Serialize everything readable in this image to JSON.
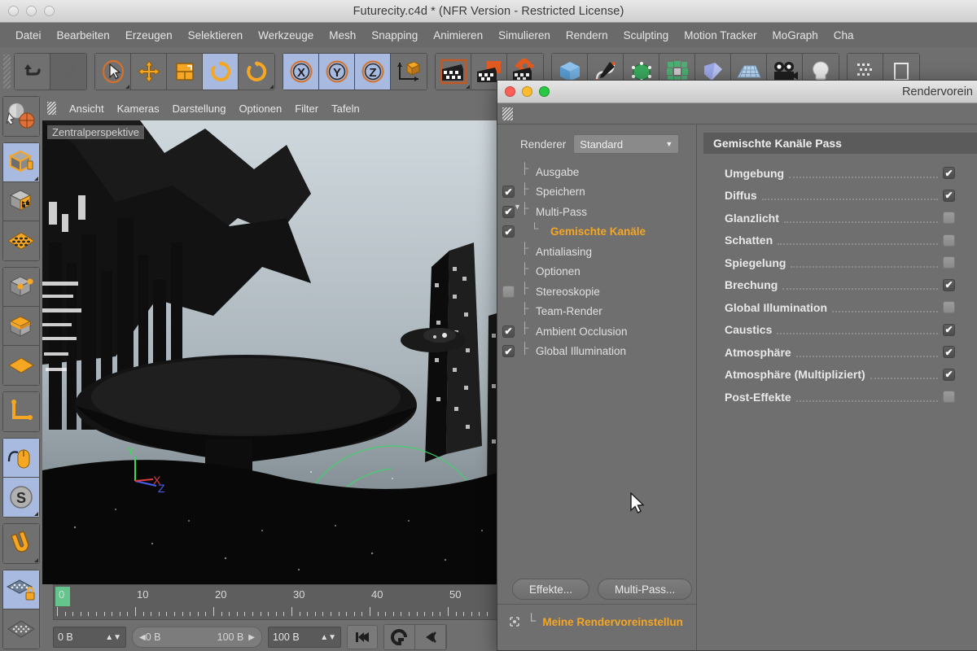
{
  "window": {
    "title": "Futurecity.c4d * (NFR Version - Restricted License)",
    "traffic_lights": [
      "close",
      "minimize",
      "zoom"
    ]
  },
  "menubar": {
    "items": [
      {
        "label": "Datei"
      },
      {
        "label": "Bearbeiten"
      },
      {
        "label": "Erzeugen"
      },
      {
        "label": "Selektieren"
      },
      {
        "label": "Werkzeuge"
      },
      {
        "label": "Mesh"
      },
      {
        "label": "Snapping"
      },
      {
        "label": "Animieren"
      },
      {
        "label": "Simulieren"
      },
      {
        "label": "Rendern"
      },
      {
        "label": "Sculpting"
      },
      {
        "label": "Motion Tracker"
      },
      {
        "label": "MoGraph"
      },
      {
        "label": "Cha"
      }
    ]
  },
  "toolbar": {
    "groups": [
      {
        "name": "history",
        "buttons": [
          {
            "icon": "undo-icon",
            "active": false,
            "dim": false
          },
          {
            "icon": "redo-icon",
            "active": false,
            "dim": true
          }
        ]
      },
      {
        "name": "transform",
        "buttons": [
          {
            "icon": "select-arrow-icon",
            "active": false,
            "dim": false,
            "corner": true
          },
          {
            "icon": "move-icon",
            "active": false,
            "dim": false
          },
          {
            "icon": "scale-icon",
            "active": false,
            "dim": false
          },
          {
            "icon": "rotate-icon",
            "active": true,
            "dim": false
          },
          {
            "icon": "rotate-alt-icon",
            "active": false,
            "dim": false,
            "corner": true
          }
        ]
      },
      {
        "name": "axis-locks",
        "buttons": [
          {
            "icon": "axis-x-icon",
            "active": true,
            "dim": false
          },
          {
            "icon": "axis-y-icon",
            "active": true,
            "dim": false
          },
          {
            "icon": "axis-z-icon",
            "active": true,
            "dim": false
          },
          {
            "icon": "world-coord-icon",
            "active": false,
            "dim": false
          }
        ]
      },
      {
        "name": "render",
        "buttons": [
          {
            "icon": "render-view-icon",
            "active": false,
            "dim": false,
            "corner": true
          },
          {
            "icon": "render-picture-viewer-icon",
            "active": false,
            "dim": false
          },
          {
            "icon": "render-settings-icon",
            "active": false,
            "dim": false
          }
        ]
      },
      {
        "name": "objects",
        "buttons": [
          {
            "icon": "cube-primitive-icon",
            "active": false,
            "dim": false
          },
          {
            "icon": "spline-pen-icon",
            "active": false,
            "dim": false
          },
          {
            "icon": "generator-icon",
            "active": false,
            "dim": false
          },
          {
            "icon": "deformer-icon",
            "active": false,
            "dim": false
          },
          {
            "icon": "environment-icon",
            "active": false,
            "dim": false
          },
          {
            "icon": "floor-icon",
            "active": false,
            "dim": false
          },
          {
            "icon": "camera-icon",
            "active": false,
            "dim": false
          },
          {
            "icon": "light-icon",
            "active": false,
            "dim": false
          }
        ]
      },
      {
        "name": "extras",
        "buttons": [
          {
            "icon": "grid-icon",
            "active": false,
            "dim": false
          },
          {
            "icon": "panel-icon",
            "active": false,
            "dim": false
          }
        ]
      }
    ]
  },
  "left_rail": {
    "groups": [
      {
        "buttons": [
          {
            "icon": "world-axis-icon",
            "active": false
          }
        ]
      },
      {
        "buttons": [
          {
            "icon": "object-mode-icon",
            "active": true,
            "corner": true
          },
          {
            "icon": "points-mode-icon",
            "active": false
          },
          {
            "icon": "polygon-mode-icon",
            "active": false
          }
        ]
      },
      {
        "buttons": [
          {
            "icon": "model-mode-icon",
            "active": false
          },
          {
            "icon": "texture-mode-icon",
            "active": false
          },
          {
            "icon": "workplane-mode-icon",
            "active": false
          }
        ]
      },
      {
        "buttons": [
          {
            "icon": "object-axis-icon",
            "active": false
          }
        ]
      },
      {
        "buttons": [
          {
            "icon": "viewport-lock-icon",
            "active": true
          },
          {
            "icon": "soft-selection-icon",
            "active": true,
            "corner": true
          }
        ]
      },
      {
        "buttons": [
          {
            "icon": "magnet-icon",
            "active": false,
            "corner": true
          }
        ]
      },
      {
        "buttons": [
          {
            "icon": "workplane-lock-icon",
            "active": true
          },
          {
            "icon": "grid-plane-icon",
            "active": false
          }
        ]
      }
    ]
  },
  "viewport": {
    "menu": [
      {
        "label": "Ansicht"
      },
      {
        "label": "Kameras"
      },
      {
        "label": "Darstellung"
      },
      {
        "label": "Optionen"
      },
      {
        "label": "Filter"
      },
      {
        "label": "Tafeln"
      }
    ],
    "label": "Zentralperspektive",
    "axis": {
      "x": "X",
      "y": "Y",
      "z": "Z",
      "x_color": "#e03a3a",
      "y_color": "#3ddb5a",
      "z_color": "#4a5ef0"
    }
  },
  "timeline": {
    "ticks": [
      "0",
      "10",
      "20",
      "30",
      "40",
      "50"
    ],
    "current_frame": "0 B",
    "range_start": "0 B",
    "range_end": "100 B",
    "max_frame": "100 B",
    "buttons": [
      {
        "icon": "go-to-start-icon"
      },
      {
        "icon": "loop-icon"
      },
      {
        "icon": "step-back-icon"
      }
    ]
  },
  "dialog": {
    "title": "Rendervorein",
    "traffic_lights": [
      {
        "name": "close",
        "color": "#ff5f57"
      },
      {
        "name": "minimize",
        "color": "#febc2e"
      },
      {
        "name": "zoom",
        "color": "#28c840"
      }
    ],
    "renderer": {
      "label": "Renderer",
      "value": "Standard"
    },
    "tree": [
      {
        "label": "Ausgabe",
        "checkbox": "none",
        "indent": 0,
        "selected": false
      },
      {
        "label": "Speichern",
        "checkbox": "checked",
        "indent": 0,
        "selected": false
      },
      {
        "label": "Multi-Pass",
        "checkbox": "checked",
        "indent": 0,
        "selected": false,
        "expanded": true
      },
      {
        "label": "Gemischte Kanäle",
        "checkbox": "checked",
        "indent": 1,
        "selected": true
      },
      {
        "label": "Antialiasing",
        "checkbox": "none",
        "indent": 0,
        "selected": false
      },
      {
        "label": "Optionen",
        "checkbox": "none",
        "indent": 0,
        "selected": false
      },
      {
        "label": "Stereoskopie",
        "checkbox": "off",
        "indent": 0,
        "selected": false
      },
      {
        "label": "Team-Render",
        "checkbox": "none",
        "indent": 0,
        "selected": false
      },
      {
        "label": "Ambient Occlusion",
        "checkbox": "checked",
        "indent": 0,
        "selected": false
      },
      {
        "label": "Global Illumination",
        "checkbox": "checked",
        "indent": 0,
        "selected": false
      }
    ],
    "pass_header": "Gemischte Kanäle Pass",
    "channels": [
      {
        "label": "Umgebung",
        "checked": true
      },
      {
        "label": "Diffus",
        "checked": true
      },
      {
        "label": "Glanzlicht",
        "checked": false
      },
      {
        "label": "Schatten",
        "checked": false
      },
      {
        "label": "Spiegelung",
        "checked": false
      },
      {
        "label": "Brechung",
        "checked": true
      },
      {
        "label": "Global Illumination",
        "checked": false
      },
      {
        "label": "Caustics",
        "checked": true
      },
      {
        "label": "Atmosphäre",
        "checked": true
      },
      {
        "label": "Atmosphäre (Multipliziert)",
        "checked": true
      },
      {
        "label": "Post-Effekte",
        "checked": false
      }
    ],
    "buttons": [
      {
        "label": "Effekte...",
        "name": "effects-button"
      },
      {
        "label": "Multi-Pass...",
        "name": "multipass-button"
      }
    ],
    "preset": "Meine Rendervoreinstellun"
  },
  "colors": {
    "accent_orange": "#f5a623",
    "panel_bg": "#6f6f6f",
    "active_blue": "#a8badf",
    "titlebar": "#d8d8d8"
  }
}
